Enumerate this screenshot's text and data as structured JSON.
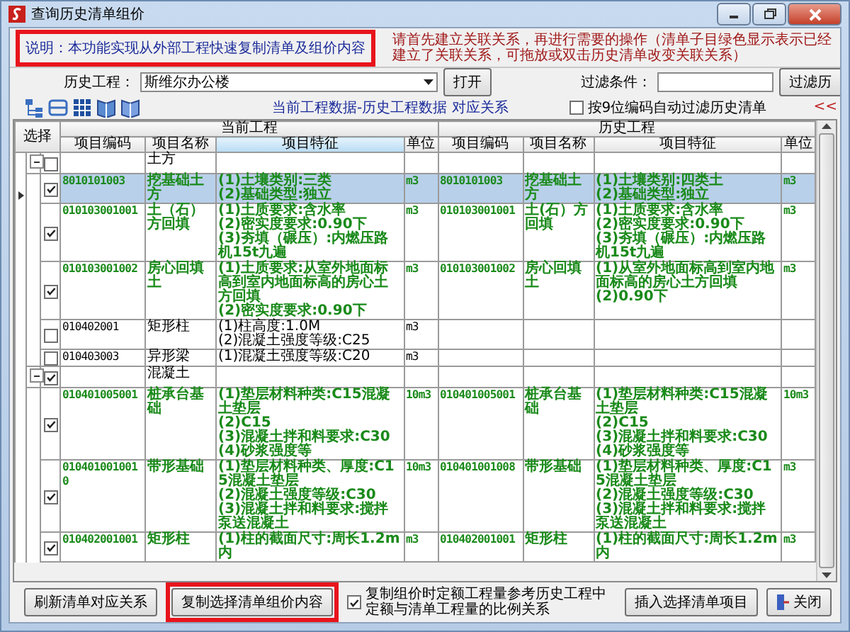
{
  "window": {
    "title": "查询历史清单组价"
  },
  "info": {
    "note": {
      "text": "说明：本功能实现从外部工程快速复制清单及组价内容",
      "highlighted": true
    },
    "hint": "请首先建立关联关系，再进行需要的操作（清单子目绿色显示表示已经建立了关联关系，可拖放或双击历史清单改变关联关系）"
  },
  "toolbar": {
    "history_label": "历史工程：",
    "history_value": "斯维尔办公楼",
    "open_button": "打开",
    "filter_label": "过滤条件：",
    "filter_button": "过滤历"
  },
  "subbar": {
    "title": "当前工程数据-历史工程数据 对应关系",
    "auto_filter": {
      "label": "按9位编码自动过滤历史清单",
      "checked": false
    },
    "collapse": "<<"
  },
  "table": {
    "select_header": "选择",
    "groups": [
      {
        "title": "当前工程",
        "columns": [
          {
            "label": "项目编码",
            "selected": false
          },
          {
            "label": "项目名称",
            "selected": false
          },
          {
            "label": "项目特征",
            "selected": true
          },
          {
            "label": "单位",
            "selected": false
          }
        ]
      },
      {
        "title": "历史工程",
        "columns": [
          {
            "label": "项目编码",
            "selected": false
          },
          {
            "label": "项目名称",
            "selected": false
          },
          {
            "label": "项目特征",
            "selected": false
          },
          {
            "label": "单位",
            "selected": false
          }
        ]
      }
    ],
    "rows": [
      {
        "kind": "group",
        "name": "土方",
        "expanded": true,
        "checked": false
      },
      {
        "kind": "item",
        "checked": true,
        "selected": true,
        "matched": true,
        "current": {
          "code": "8010101003",
          "name": "挖基础土方",
          "features": [
            "(1)土壤类别:三类",
            "(2)基础类型:独立"
          ],
          "unit": "m3"
        },
        "history": {
          "code": "8010101003",
          "name": "挖基础土方",
          "features": [
            "(1)土壤类别:四类土",
            "(2)基础类型:独立"
          ],
          "unit": "m3"
        }
      },
      {
        "kind": "item",
        "checked": true,
        "selected": false,
        "matched": true,
        "current": {
          "code": "010103001001",
          "name": "土（石）方回填",
          "features": [
            "(1)土质要求:含水率",
            "(2)密实度要求:0.90下",
            "(3)夯填（碾压）:内燃压路机15t九遍"
          ],
          "unit": "m3"
        },
        "history": {
          "code": "010103001001",
          "name": "土(石）方回填",
          "features": [
            "(1)土质要求:含水率",
            "(2)密实度要求:0.90下",
            "(3)夯填（碾压）:内燃压路机15t九遍"
          ],
          "unit": "m3"
        }
      },
      {
        "kind": "item",
        "checked": true,
        "selected": false,
        "matched": true,
        "current": {
          "code": "010103001002",
          "name": "房心回填土",
          "features": [
            "(1)土质要求:从室外地面标高到室内地面标高的房心土方回填",
            "(2)密实度要求:0.90下"
          ],
          "unit": "m3"
        },
        "history": {
          "code": "010103001002",
          "name": "房心回填土",
          "features": [
            "(1)从室外地面标高到室内地面标高的房心土方回填",
            "(2)0.90下"
          ],
          "unit": "m3"
        }
      },
      {
        "kind": "item",
        "checked": false,
        "selected": false,
        "matched": false,
        "current": {
          "code": "010402001",
          "name": "矩形柱",
          "features": [
            "(1)柱高度:1.0M",
            "(2)混凝土强度等级:C25"
          ],
          "unit": "m3"
        }
      },
      {
        "kind": "item",
        "checked": false,
        "selected": false,
        "matched": false,
        "current": {
          "code": "010403003",
          "name": "异形梁",
          "features": [
            "(1)混凝土强度等级:C20"
          ],
          "unit": "m3"
        }
      },
      {
        "kind": "group",
        "name": "混凝土",
        "expanded": true,
        "checked": true
      },
      {
        "kind": "item",
        "checked": true,
        "selected": false,
        "matched": true,
        "current": {
          "code": "010401005001",
          "name": "桩承台基础",
          "features": [
            "(1)垫层材料种类:C15混凝土垫层",
            "(2)C15",
            "(3)混凝土拌和料要求:C30",
            "(4)砂浆强度等"
          ],
          "unit": "10m3"
        },
        "history": {
          "code": "010401005001",
          "name": "桩承台基础",
          "features": [
            "(1)垫层材料种类:C15混凝土垫层",
            "(2)C15",
            "(3)混凝土拌和料要求:C30",
            "(4)砂浆强度等"
          ],
          "unit": "10m3"
        }
      },
      {
        "kind": "item",
        "checked": true,
        "selected": false,
        "matched": true,
        "current": {
          "code": "0104010010010",
          "name": "带形基础",
          "features": [
            "(1)垫层材料种类、厚度:C15混凝土垫层",
            "(2)混凝土强度等级:C30",
            "(3)混凝土拌和料要求:搅拌泵送混凝土"
          ],
          "unit": "10m3"
        },
        "history": {
          "code": "010401001008",
          "name": "带形基础",
          "features": [
            "(1)垫层材料种类、厚度:C15混凝土垫层",
            "(2)混凝土强度等级:C30",
            "(3)混凝土拌和料要求:搅拌泵送混凝土"
          ],
          "unit": "m3"
        }
      },
      {
        "kind": "item",
        "checked": true,
        "selected": false,
        "matched": true,
        "current": {
          "code": "010402001001",
          "name": "矩形柱",
          "features": [
            "(1)柱的截面尺寸:周长1.2m内"
          ],
          "unit": "m3"
        },
        "history": {
          "code": "010402001001",
          "name": "矩形柱",
          "features": [
            "(1)柱的截面尺寸:周长1.2m内"
          ],
          "unit": "m3"
        }
      }
    ]
  },
  "bottom": {
    "refresh_button": "刷新清单对应关系",
    "copy_button": {
      "label": "复制选择清单组价内容",
      "highlighted": true
    },
    "ratio": {
      "label": "复制组价时定额工程量参考历史工程中定额与清单工程量的比例关系",
      "checked": true
    },
    "insert_button": "插入选择清单项目",
    "close_button": "关闭"
  }
}
